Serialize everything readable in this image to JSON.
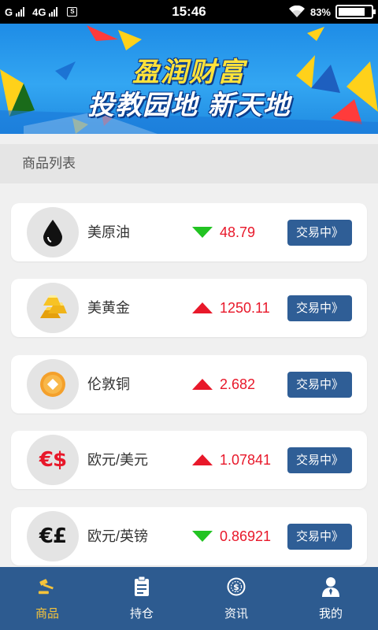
{
  "status_bar": {
    "carrier_left": "G",
    "network": "4G",
    "sim_label": "S",
    "time": "15:46",
    "battery_percent": "83%",
    "battery_level": 0.83
  },
  "banner": {
    "line1": "盈润财富",
    "line2": "投教园地 新天地"
  },
  "section": {
    "title": "商品列表"
  },
  "colors": {
    "up": "#e8182a",
    "down": "#22c322",
    "trade_button": "#2f5e96",
    "nav_bg": "#2d5b90",
    "nav_active": "#f5c33b"
  },
  "products": [
    {
      "name": "美原油",
      "price": "48.79",
      "trend": "down",
      "icon": "oil-drop-icon",
      "button": "交易中》"
    },
    {
      "name": "美黄金",
      "price": "1250.11",
      "trend": "up",
      "icon": "gold-bars-icon",
      "button": "交易中》"
    },
    {
      "name": "伦敦铜",
      "price": "2.682",
      "trend": "up",
      "icon": "copper-coin-icon",
      "button": "交易中》"
    },
    {
      "name": "欧元/美元",
      "price": "1.07841",
      "trend": "up",
      "icon": "euro-dollar-icon",
      "icon_text": "€$",
      "button": "交易中》"
    },
    {
      "name": "欧元/英镑",
      "price": "0.86921",
      "trend": "down",
      "icon": "euro-pound-icon",
      "icon_text": "€£",
      "button": "交易中》"
    }
  ],
  "nav": {
    "items": [
      {
        "label": "商品",
        "icon": "gavel-icon",
        "active": true
      },
      {
        "label": "持仓",
        "icon": "clipboard-icon",
        "active": false
      },
      {
        "label": "资讯",
        "icon": "dollar-globe-icon",
        "active": false
      },
      {
        "label": "我的",
        "icon": "user-icon",
        "active": false
      }
    ]
  }
}
